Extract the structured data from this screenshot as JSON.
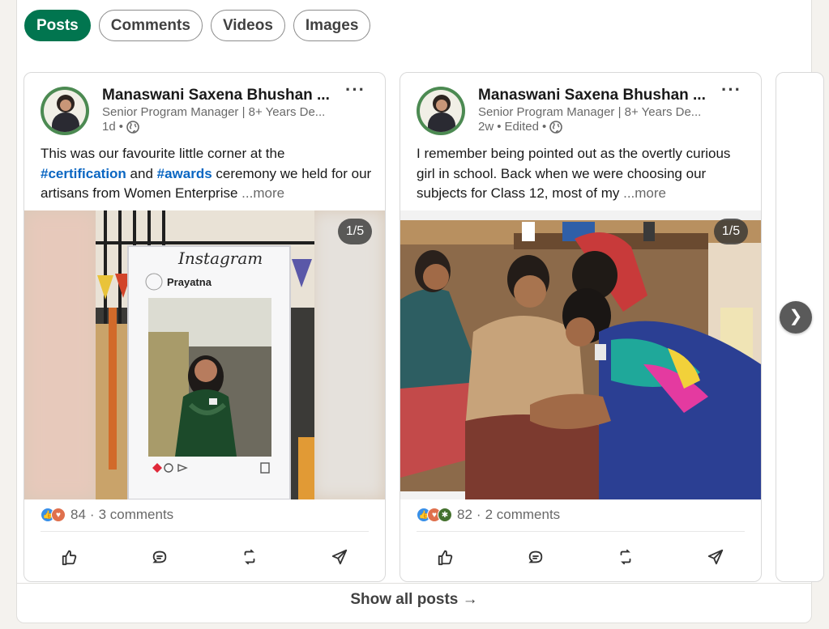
{
  "tabs": [
    {
      "label": "Posts",
      "active": true
    },
    {
      "label": "Comments",
      "active": false
    },
    {
      "label": "Videos",
      "active": false
    },
    {
      "label": "Images",
      "active": false
    }
  ],
  "posts": [
    {
      "author": "Manaswani Saxena Bhushan (She/Her)",
      "author_display": "Manaswani Saxena Bhushan ...",
      "headline": "Senior Program Manager | 8+ Years De...",
      "time": "1d",
      "edited": "",
      "text_before": "This was our favourite little corner at the ",
      "hashtag1": "#certification",
      "text_mid": " and ",
      "hashtag2": "#awards",
      "text_after": " ceremony we held for our artisans from Women Enterprise ",
      "more": "...more",
      "image_counter": "1/5",
      "instagram_label": "Instagram",
      "instagram_account": "Prayatna",
      "reaction_count": "84",
      "comments": "3 comments",
      "reaction_icons": [
        "like-icon",
        "love-icon"
      ]
    },
    {
      "author": "Manaswani Saxena Bhushan (She/Her)",
      "author_display": "Manaswani Saxena Bhushan ...",
      "headline": "Senior Program Manager | 8+ Years De...",
      "time": "2w",
      "edited": "Edited",
      "text_before": "I remember being pointed out as the overtly curious girl in school. Back when we were choosing our subjects for Class 12, most of my ",
      "more": "...more",
      "image_counter": "1/5",
      "reaction_count": "82",
      "comments": "2 comments",
      "reaction_icons": [
        "like-icon",
        "love-icon",
        "insightful-icon"
      ]
    }
  ],
  "separator": "•",
  "separator_stats": "·",
  "next_arrow": "❯",
  "footer": {
    "show_all": "Show all posts →"
  },
  "colors": {
    "accent_green": "#01754f",
    "link_blue": "#0a66c2"
  }
}
